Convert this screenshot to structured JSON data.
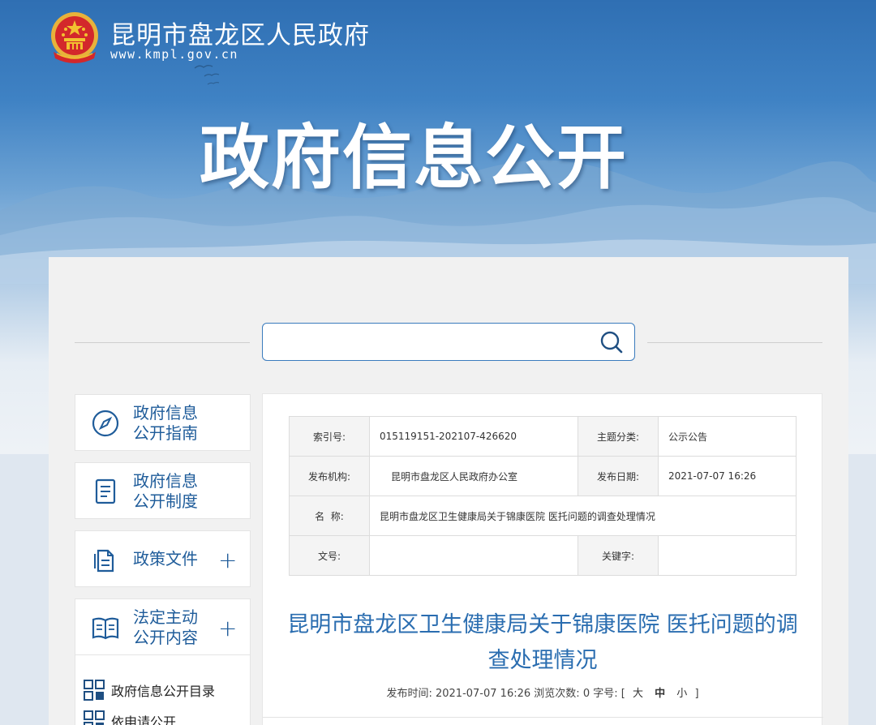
{
  "header": {
    "site_name": "昆明市盘龙区人民政府",
    "site_url": "www.kmpl.gov.cn",
    "banner_title": "政府信息公开",
    "icons": [
      "national-emblem-icon",
      "birds-decoration"
    ]
  },
  "search": {
    "value": "",
    "placeholder": "",
    "icon": "search-icon"
  },
  "sidebar": {
    "items": [
      {
        "label": "政府信息\n公开指南",
        "icon": "compass-icon",
        "expandable": false
      },
      {
        "label": "政府信息\n公开制度",
        "icon": "document-list-icon",
        "expandable": false
      },
      {
        "label": "政策文件",
        "icon": "files-icon",
        "expandable": true,
        "plus": "+"
      },
      {
        "label": "法定主动\n公开内容",
        "icon": "open-book-icon",
        "expandable": true,
        "plus": "+"
      }
    ],
    "sub_items": [
      {
        "label": "政府信息公开目录",
        "icon": "grid-icon"
      },
      {
        "label": "依申请公开",
        "icon": "grid-icon"
      }
    ]
  },
  "meta_table": {
    "rows": [
      {
        "k1": "索引号:",
        "v1": "015119151-202107-426620",
        "k2": "主题分类:",
        "v2": "公示公告"
      },
      {
        "k1": "发布机构:",
        "v1": "昆明市盘龙区人民政府办公室",
        "k2": "发布日期:",
        "v2": "2021-07-07 16:26"
      },
      {
        "k1": "名  称:",
        "v_full": "昆明市盘龙区卫生健康局关于锦康医院 医托问题的调查处理情况"
      },
      {
        "k1": "文号:",
        "v1": "",
        "k2": "关键字:",
        "v2": ""
      }
    ]
  },
  "article": {
    "title": "昆明市盘龙区卫生健康局关于锦康医院 医托问题的调查处理情况",
    "publish_label": "发布时间:",
    "publish_time": "2021-07-07 16:26",
    "views_label": "浏览次数:",
    "views": "0",
    "fontsize_label": "字号:",
    "bracket_open": "[",
    "size_large": "大",
    "size_medium": "中",
    "size_small": "小",
    "bracket_close": "]"
  },
  "colors": {
    "accent_blue": "#2a6db0",
    "sidebar_text": "#1f5c9a",
    "banner_top": "#2f6fb3",
    "emblem_red": "#d3282b",
    "emblem_gold": "#f2c230"
  }
}
